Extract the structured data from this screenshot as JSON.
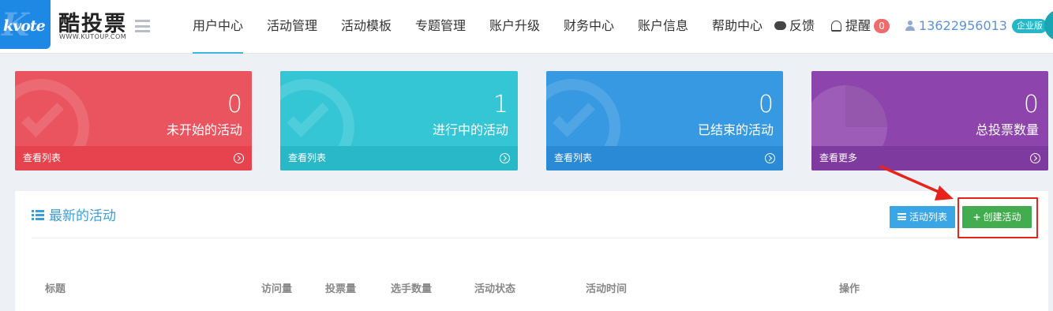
{
  "brand": {
    "logo_text": "kvote",
    "name": "酷投票",
    "url": "WWW.KUTOUP.COM"
  },
  "nav": {
    "items": [
      {
        "label": "用户中心",
        "active": true
      },
      {
        "label": "活动管理"
      },
      {
        "label": "活动模板"
      },
      {
        "label": "专题管理"
      },
      {
        "label": "账户升级"
      },
      {
        "label": "财务中心"
      },
      {
        "label": "账户信息"
      },
      {
        "label": "帮助中心"
      }
    ],
    "feedback": "反馈",
    "remind": "提醒",
    "remind_count": "0",
    "phone": "13622956013",
    "account_type": "企业版"
  },
  "stats": [
    {
      "value": "0",
      "label": "未开始的活动",
      "link": "查看列表",
      "color": "#ea545f"
    },
    {
      "value": "1",
      "label": "进行中的活动",
      "link": "查看列表",
      "color": "#34c6d5"
    },
    {
      "value": "0",
      "label": "已结束的活动",
      "link": "查看列表",
      "color": "#3799e1"
    },
    {
      "value": "0",
      "label": "总投票数量",
      "link": "查看更多",
      "color": "#8e44ad"
    }
  ],
  "panel": {
    "title": "最新的活动",
    "btn_list": "活动列表",
    "btn_create": "创建活动",
    "columns": [
      "标题",
      "访问量",
      "投票量",
      "选手数量",
      "活动状态",
      "活动时间",
      "操作"
    ]
  },
  "colors": {
    "accent": "#39b5e8",
    "create_button": "#43ac4f",
    "highlight": "#e8231c"
  }
}
